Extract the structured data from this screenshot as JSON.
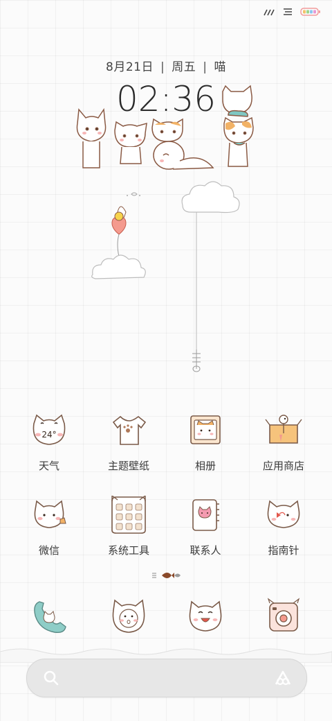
{
  "status_bar": {
    "icons": [
      "signal-icon",
      "wifi-icon",
      "battery-icon"
    ]
  },
  "lockscreen": {
    "date": "8月21日",
    "weekday": "周五",
    "tag": "喵",
    "time": "02:36"
  },
  "apps": [
    {
      "label": "天气",
      "icon": "weather-cat-icon",
      "badge": "24°"
    },
    {
      "label": "主题壁纸",
      "icon": "tshirt-icon"
    },
    {
      "label": "相册",
      "icon": "album-cat-icon"
    },
    {
      "label": "应用商店",
      "icon": "app-store-box-icon"
    },
    {
      "label": "微信",
      "icon": "wechat-cat-icon"
    },
    {
      "label": "系统工具",
      "icon": "system-tools-folder-icon"
    },
    {
      "label": "联系人",
      "icon": "contacts-book-icon"
    },
    {
      "label": "指南针",
      "icon": "compass-cat-icon"
    }
  ],
  "dock": [
    {
      "icon": "phone-cat-icon"
    },
    {
      "icon": "messages-cat-icon"
    },
    {
      "icon": "browser-cat-icon"
    },
    {
      "icon": "camera-icon"
    }
  ],
  "colors": {
    "accent": "#f4a6a6",
    "outline": "#8a5a44",
    "orange": "#f2b266"
  }
}
